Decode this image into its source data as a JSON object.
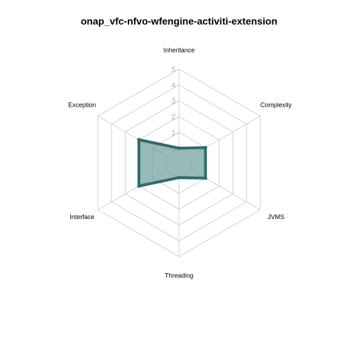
{
  "chart_data": {
    "type": "radar",
    "title": "onap_vfc-nfvo-wfengine-activiti-extension",
    "axes": [
      "Inheritance",
      "Complexity",
      "JVMS",
      "Threading",
      "Interface",
      "Exception"
    ],
    "ticks": [
      "0",
      "1",
      "2",
      "3",
      "4",
      "5"
    ],
    "range": [
      0,
      5
    ],
    "grid": true,
    "series": [
      {
        "values": [
          0,
          1,
          1,
          0,
          2,
          2
        ]
      }
    ],
    "colors": {
      "line": "#2f6b6a",
      "fill": "#6d9c9c",
      "grid": "#d0d0d0"
    }
  }
}
